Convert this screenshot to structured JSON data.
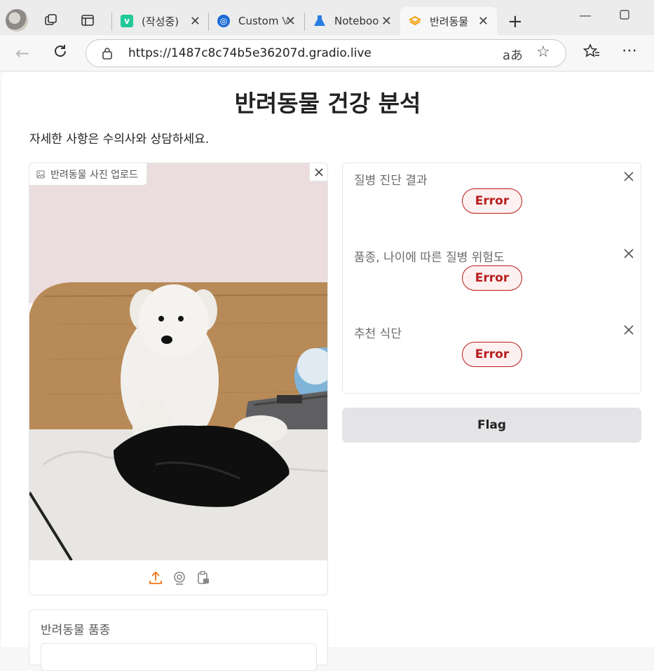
{
  "browser": {
    "tabs": [
      {
        "title": "(작성중)",
        "favicon": "v-icon",
        "color": "#20c997"
      },
      {
        "title": "Custom V",
        "favicon": "target-icon",
        "color": "#1e6bd6"
      },
      {
        "title": "Noteboo",
        "favicon": "flask-icon",
        "color": "#2a7de1"
      },
      {
        "title": "반려동물",
        "favicon": "gradio-icon",
        "color": "#f59e0b",
        "active": true
      }
    ],
    "url": "https://1487c8c74b5e36207d.gradio.live"
  },
  "page": {
    "title": "반려동물 건강 분석",
    "description": "자세한 사항은 수의사와 상담하세요.",
    "image_input": {
      "label": "반려동물 사진 업로드"
    },
    "breed_input": {
      "label": "반려동물 품종"
    },
    "outputs": [
      {
        "label": "질병 진단 결과",
        "status": "Error"
      },
      {
        "label": "품종, 나이에 따른 질병 위험도",
        "status": "Error"
      },
      {
        "label": "추천 식단",
        "status": "Error"
      }
    ],
    "flag_button": "Flag"
  },
  "colors": {
    "error": "#b91c1c",
    "accent_upload": "#f97316"
  }
}
